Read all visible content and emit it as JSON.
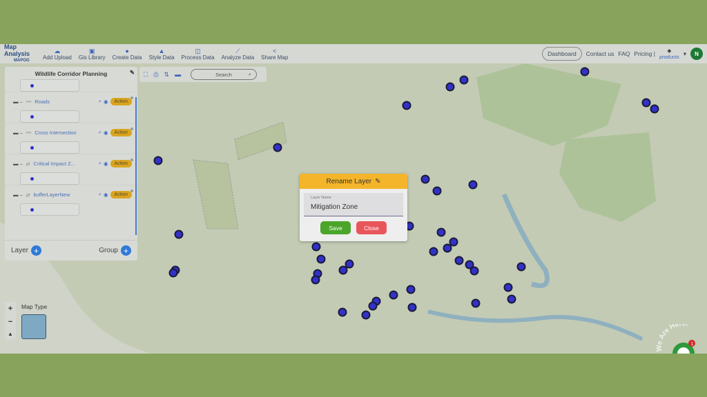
{
  "app": {
    "logo_title": "Map Analysis",
    "logo_sub": "MAPOG"
  },
  "nav": [
    {
      "label": "Add Upload",
      "icon": "cloud-upload-icon"
    },
    {
      "label": "Gis Library",
      "icon": "library-icon"
    },
    {
      "label": "Create Data",
      "icon": "location-pin-icon"
    },
    {
      "label": "Style Data",
      "icon": "paint-bucket-icon"
    },
    {
      "label": "Process Data",
      "icon": "process-icon"
    },
    {
      "label": "Analyze Data",
      "icon": "analyze-icon"
    },
    {
      "label": "Share Map",
      "icon": "share-icon"
    }
  ],
  "header_right": {
    "dashboard": "Dashboard",
    "contact": "Contact us",
    "faq": "FAQ",
    "pricing": "Pricing |",
    "products": "products",
    "avatar": "N"
  },
  "panel": {
    "title": "Wildlife Corridor Planning",
    "layers": [
      {
        "name": "Roads",
        "type": "line"
      },
      {
        "name": "Cross Intersection",
        "type": "line"
      },
      {
        "name": "Critical Impact Z...",
        "type": "polygon"
      },
      {
        "name": "bufferLayerNew",
        "type": "polygon"
      }
    ],
    "action_label": "Action",
    "layer_label": "Layer",
    "group_label": "Group"
  },
  "toolbar": {
    "search_placeholder": "Search"
  },
  "map": {
    "map_type_label": "Map Type",
    "point_color": "#3232c8"
  },
  "modal": {
    "title": "Rename Layer",
    "field_label": "Layer Name",
    "field_value": "Mitigation Zone",
    "save": "Save",
    "close": "Close"
  },
  "widget": {
    "text": "We Are Here!",
    "badge": "1"
  }
}
